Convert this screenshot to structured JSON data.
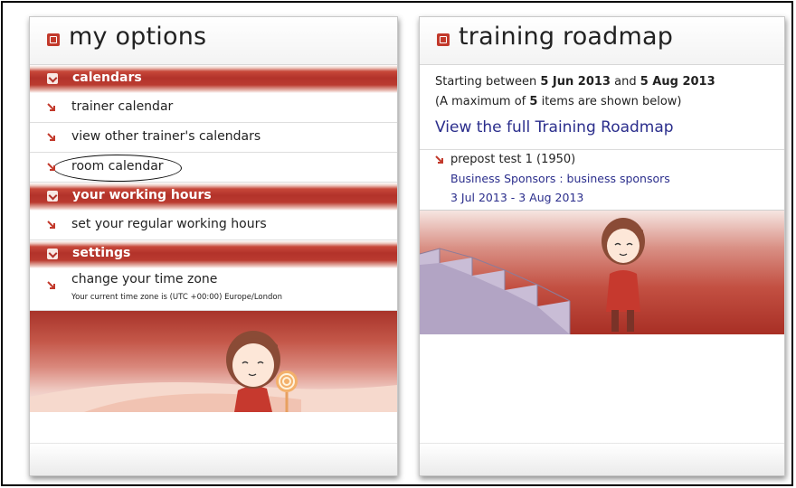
{
  "left_panel": {
    "title": "my options",
    "sections": [
      {
        "label": "calendars",
        "items": [
          {
            "label": "trainer calendar"
          },
          {
            "label": "view other trainer's calendars"
          },
          {
            "label": "room calendar"
          }
        ]
      },
      {
        "label": "your working hours",
        "items": [
          {
            "label": "set your regular working hours"
          }
        ]
      },
      {
        "label": "settings",
        "items": [
          {
            "label": "change your time zone",
            "sub": "Your current time zone is (UTC +00:00) Europe/London"
          }
        ]
      }
    ]
  },
  "right_panel": {
    "title": "training roadmap",
    "range_prefix": "Starting between ",
    "range_start": "5 Jun 2013",
    "range_mid": " and ",
    "range_end": "5 Aug 2013",
    "max_prefix": "(A maximum of ",
    "max_count": "5",
    "max_suffix": " items are shown below)",
    "full_link": "View the full Training Roadmap",
    "items": [
      {
        "title": "prepost test 1 (1950)",
        "sponsor": "Business Sponsors : business sponsors",
        "dates": "3 Jul 2013 - 3 Aug 2013"
      }
    ]
  },
  "colors": {
    "accent": "#b2322a",
    "link": "#2b2e8c"
  }
}
